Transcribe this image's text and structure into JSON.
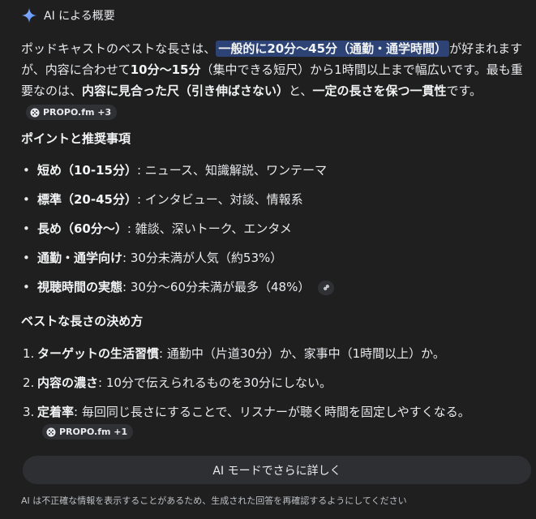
{
  "header": {
    "icon": "ai-sparkle-icon",
    "title": "AI による概要"
  },
  "intro": {
    "t1": "ポッドキャストのベストな長さは、",
    "highlight": "一般的に20分〜45分（通勤・通学時間）",
    "t2": "が好まれますが、内容に合わせて",
    "b1": "10分〜15分",
    "t3": "（集中できる短尺）から1時間以上まで幅広いです。最も重要なのは、",
    "b2": "内容に見合った尺（引き伸ばさない）",
    "t4": "と、",
    "b3": "一定の長さを保つ一貫性",
    "t5": "です。",
    "chip": "PROPO.fm +3"
  },
  "points": {
    "heading": "ポイントと推奨事項",
    "items": [
      {
        "bold": "短め（10-15分）",
        "text": ": ニュース、知識解説、ワンテーマ"
      },
      {
        "bold": "標準（20-45分）",
        "text": ": インタビュー、対談、情報系"
      },
      {
        "bold": "長め（60分〜）",
        "text": ": 雑談、深いトーク、エンタメ"
      },
      {
        "bold": "通勤・通学向け",
        "text": ": 30分未満が人気（約53%）"
      },
      {
        "bold": "視聴時間の実態",
        "text": ": 30分〜60分未満が最多（48%）"
      }
    ]
  },
  "howto": {
    "heading": "ベストな長さの決め方",
    "items": [
      {
        "num": "1.",
        "bold": "ターゲットの生活習慣",
        "text": ": 通勤中（片道30分）か、家事中（1時間以上）か。"
      },
      {
        "num": "2.",
        "bold": "内容の濃さ",
        "text": ": 10分で伝えられるものを30分にしない。"
      },
      {
        "num": "3.",
        "bold": "定着率",
        "text": ": 毎回同じ長さにすることで、リスナーが聴く時間を固定しやすくなる。"
      }
    ],
    "chip": "PROPO.fm +1"
  },
  "ai_mode_button": "AI モードでさらに詳しく",
  "disclaimer": "AI は不正確な情報を表示することがあるため、生成された回答を再確認するようにしてください",
  "colors": {
    "background": "#1f1f1f",
    "highlight": "#2d4275",
    "chip_bg": "#303134",
    "sparkle_blue": "#4c8df6"
  }
}
